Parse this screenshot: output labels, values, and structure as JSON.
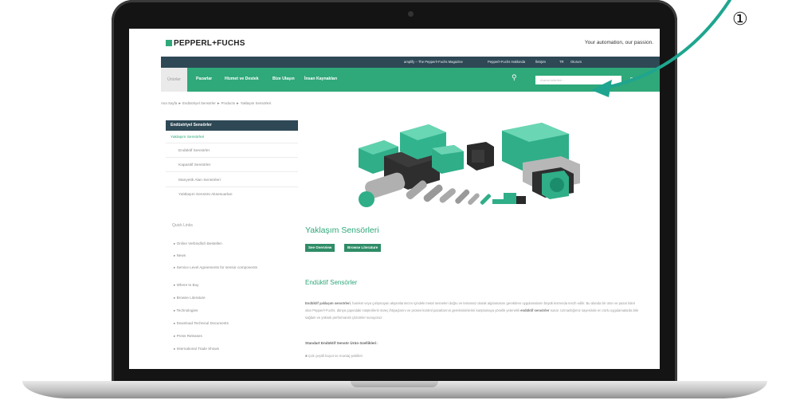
{
  "annotation": {
    "marker": "①",
    "arrow_color": "#1fa58f"
  },
  "site": {
    "logo": "PEPPERL+FUCHS",
    "tagline": "Your automation, our passion.",
    "utility_links": [
      "amplify – The Pepperl+Fuchs Magazine",
      "Pepperl+Fuchs Hakkında",
      "İletişim",
      "TR",
      "Oturum"
    ],
    "nav": [
      "Ürünler",
      "Pazarlar",
      "Hizmet ve Destek",
      "Bize Ulaşın",
      "İnsan Kaynakları"
    ],
    "search_placeholder": "Arama kriterleri…",
    "breadcrumb": "Ana Sayfa  ►  Endüstriyel Sensörler  ►  Products  ►  Yaklaşım Sensörleri",
    "sidebar": {
      "heading": "Endüstriyel Sensörler",
      "selected": "Yaklaşım Sensörleri",
      "items": [
        "Endüktif Sensörler",
        "Kapasitif Sensörler",
        "Manyetik Alan Sensörleri",
        "Yalıtlaşım Sensörü Aksesuarları"
      ]
    },
    "quick_links": {
      "title": "Quick Links",
      "items": [
        "Online Verbindlich Bestellen",
        "News",
        "Service Level Agreements for sensor components",
        "Where to Buy",
        "Browse Literature",
        "Technologies",
        "Download Technical Documents",
        "Press Releases",
        "International Trade Shows"
      ]
    },
    "main": {
      "title": "Yaklaşım Sensörleri",
      "buttons": [
        "See Overview",
        "Browse Literature"
      ],
      "subtitle": "Endüktif Sensörler",
      "para1_bold": "Endüktif yaklaşım sensörleri",
      "para1": ", hareket veya çalışmayan akşamlarımızın içindeki metal nesneleri doğru ve temassız olarak algılamasını gerektiren uygulamaların büyük kısmında tercih edilir. Bu alanda bir ürün ve pazar lideri olan Pepperl+Fuchs, dünya çapındaki müşterilerin süreç ihtiyaçlarını ve proses kontrol pazarlarının gereksinimlerini karşılamaya yönelik yetenekli ",
      "para1_bold2": "endüktif sensörler",
      "para1_end": " sunar. Uzmanlığımız sayesinde en zorlu uygulamalarda bile sağlam ve yüksek performanslı çözümler sunuyoruz.",
      "std_heading": "Standart Endüktif Sensör Ürün özellikleri:",
      "bullet": "■ Çok çeşitli boyut ve montaj şekilleri"
    }
  },
  "colors": {
    "accent": "#2fa87a",
    "dark": "#2e4855"
  }
}
